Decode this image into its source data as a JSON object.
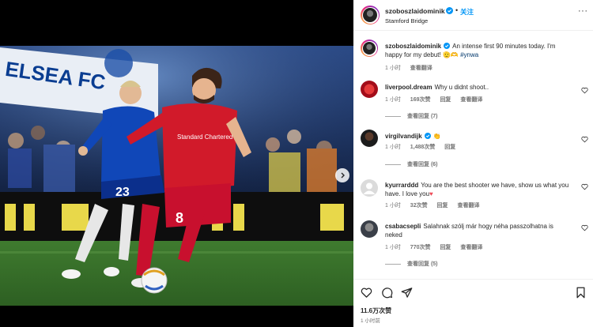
{
  "post": {
    "username": "szoboszlaidominik",
    "dot": "•",
    "follow_label": "关注",
    "location": "Stamford Bridge",
    "more": "···"
  },
  "caption": {
    "username": "szoboszlaidominik",
    "text": "An intense first 90 minutes today. I'm happy for my debut! ",
    "emoji": "🫡🫶",
    "hashtag": "#ynwa",
    "time": "1 小时",
    "translate": "查看翻译"
  },
  "comments": [
    {
      "username": "liverpool.dream",
      "text": "Why u didnt shoot..",
      "time": "1 小时",
      "likes": "169次赞",
      "reply": "回复",
      "translate": "查看翻译",
      "view_replies": "查看回复 (7)"
    },
    {
      "username": "virgilvandijk",
      "text": "👏",
      "time": "1 小时",
      "likes": "1,488次赞",
      "reply": "回复",
      "view_replies": "查看回复 (6)"
    },
    {
      "username": "kyurrarddd",
      "text": "You are the best shooter we have, show us what you have. I love you",
      "text_emoji": "♥",
      "time": "1 小时",
      "likes": "32次赞",
      "reply": "回复",
      "translate": "查看翻译"
    },
    {
      "username": "csabacsepli",
      "text": "Salahnak szólj már hogy néha passzolhatna is neked",
      "time": "1 小时",
      "likes": "770次赞",
      "reply": "回复",
      "translate": "查看翻译",
      "view_replies": "查看回复 (5)"
    }
  ],
  "footer": {
    "likes": "11.6万次赞",
    "time": "1 小时前"
  },
  "photo": {
    "player_shirt_number": "8",
    "opponent_shirt_number": "23",
    "sponsor": "Standard Chartered",
    "banner_text": "ELSEA FC"
  },
  "colors": {
    "accent": "#0095f6",
    "heart_red": "#ed4956",
    "liverpool_red": "#c8102e",
    "chelsea_blue": "#034694"
  },
  "icons": {
    "verified": "verified-badge-icon",
    "more": "more-options-icon",
    "heart": "heart-icon",
    "comment": "comment-icon",
    "share": "share-icon",
    "save": "bookmark-icon",
    "next": "chevron-right-icon"
  }
}
